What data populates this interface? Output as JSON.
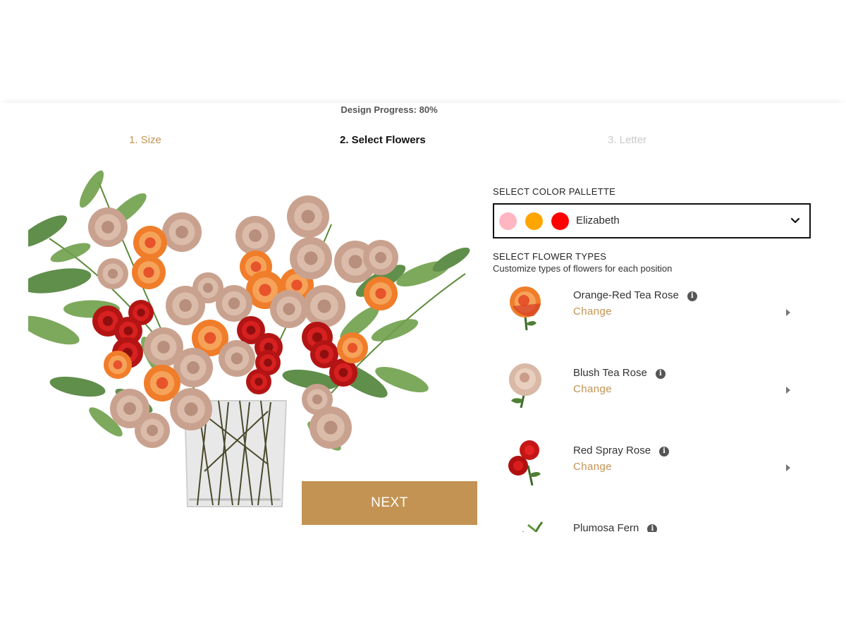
{
  "colors": {
    "accent": "#c39353",
    "active_step": "#111111",
    "inactive_step": "#c9c9c9"
  },
  "progress": {
    "label": "Design Progress: 80%",
    "percent": 80
  },
  "steps": [
    {
      "label": "1. Size",
      "state": "done"
    },
    {
      "label": "2. Select Flowers",
      "state": "active"
    },
    {
      "label": "3. Letter",
      "state": "todo"
    }
  ],
  "palette": {
    "label": "SELECT COLOR PALLETTE",
    "selected": "Elizabeth",
    "swatches": [
      "#ffb6c1",
      "#ffa500",
      "#ff0000"
    ],
    "icon": "chevron-down-icon"
  },
  "flower_types": {
    "label": "SELECT FLOWER TYPES",
    "subtitle": "Customize types of flowers for each position",
    "change_label": "Change",
    "items": [
      {
        "name": "Orange-Red Tea Rose",
        "icon": "orange-red-rose-thumbnail"
      },
      {
        "name": "Blush Tea Rose",
        "icon": "blush-rose-thumbnail"
      },
      {
        "name": "Red Spray Rose",
        "icon": "red-spray-rose-thumbnail"
      },
      {
        "name": "Plumosa Fern",
        "icon": "fern-thumbnail"
      }
    ]
  },
  "next_button": {
    "label": "NEXT"
  }
}
